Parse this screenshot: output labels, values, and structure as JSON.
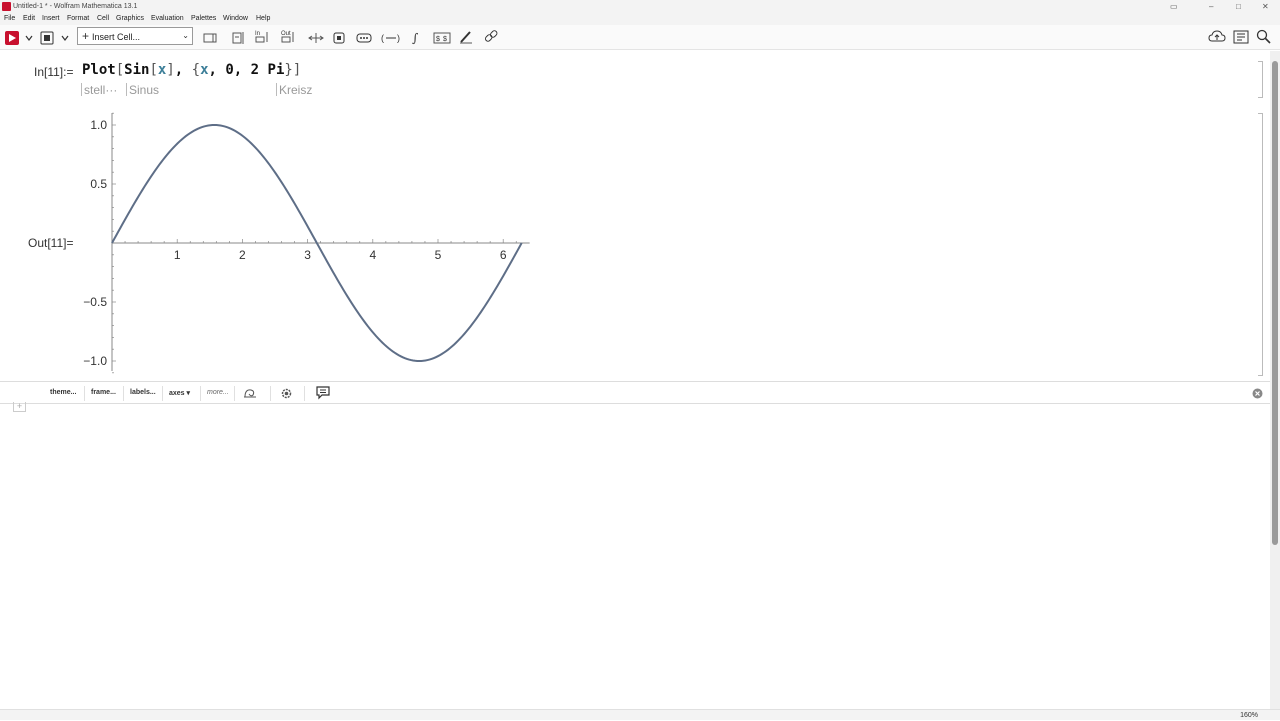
{
  "window": {
    "title": "Untitled-1 * - Wolfram Mathematica 13.1",
    "controls": [
      "minimize-icon",
      "restore-icon",
      "close-icon"
    ]
  },
  "menu": [
    "File",
    "Edit",
    "Insert",
    "Format",
    "Cell",
    "Graphics",
    "Evaluation",
    "Palettes",
    "Window",
    "Help"
  ],
  "toolbar": {
    "insert_cell_label": "Insert Cell...",
    "icons": [
      "evaluate-icon",
      "stop-icon",
      "cell-icon",
      "group-icon",
      "input-icon",
      "output-icon",
      "resize-icon",
      "box-icon",
      "ellipsis-icon",
      "brackets-icon",
      "sum-icon",
      "dollar-icon",
      "pen-icon",
      "link-icon",
      "cloud-icon",
      "notebook-icon",
      "zoom-icon"
    ],
    "out_label": "Out"
  },
  "notebook": {
    "in_label": "In[11]:=",
    "code": {
      "plot": "Plot",
      "open1": "[",
      "sin": "Sin",
      "open2": "[",
      "x1": "x",
      "close2": "]",
      "comma1": ", ",
      "brace_open": "{",
      "x2": "x",
      "comma2": ", ",
      "zero": "0",
      "comma3": ", ",
      "two": "2",
      "pi": "Pi",
      "brace_close": "}",
      "close1": "]"
    },
    "hints": [
      "stell···",
      "Sinus",
      "Kreisz"
    ],
    "out_label": "Out[11]="
  },
  "chart_data": {
    "type": "line",
    "function": "Sin[x]",
    "x_range": [
      0,
      6.283
    ],
    "ylim": [
      -1.0,
      1.0
    ],
    "x_ticks": [
      "1",
      "2",
      "3",
      "4",
      "5",
      "6"
    ],
    "y_ticks": [
      "1.0",
      "0.5",
      "-0.5",
      "-1.0"
    ],
    "series": [
      {
        "x": [
          0,
          0.5,
          1,
          1.5,
          1.571,
          2,
          2.5,
          3,
          3.142,
          3.5,
          4,
          4.5,
          4.712,
          5,
          5.5,
          6,
          6.283
        ],
        "y": [
          0,
          0.479,
          0.841,
          0.997,
          1.0,
          0.909,
          0.598,
          0.141,
          0,
          -0.351,
          -0.757,
          -0.978,
          -1.0,
          -0.959,
          -0.706,
          -0.279,
          0
        ]
      }
    ],
    "line_color": "#5e6e87",
    "grid": false
  },
  "suggestions": {
    "items": [
      "theme...",
      "frame...",
      "labels...",
      "axes ▾",
      "more..."
    ],
    "icons": [
      "curve-icon",
      "gear-icon",
      "chat-icon",
      "close-circle-icon"
    ]
  },
  "status": {
    "zoom": "160%"
  }
}
